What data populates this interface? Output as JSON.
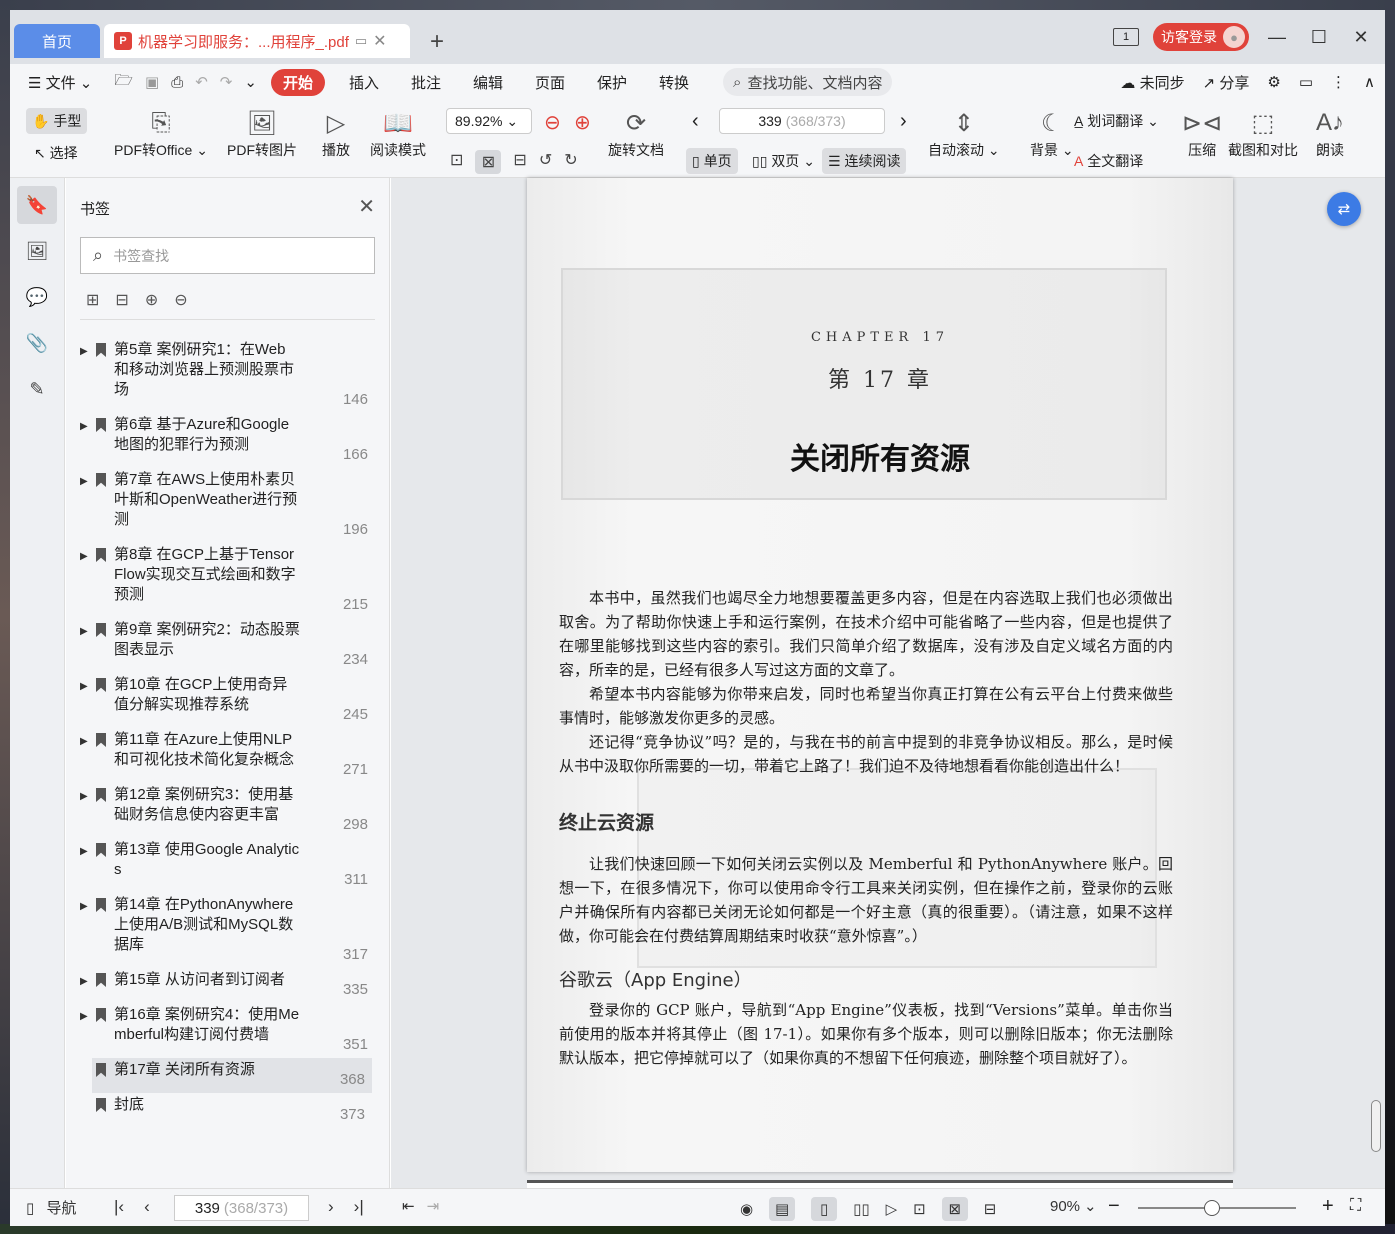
{
  "window": {
    "home_tab": "首页",
    "doc_tab": "机器学习即服务：...用程序_.pdf",
    "login": "访客登录",
    "page_badge": "1"
  },
  "menu": {
    "file": "文件",
    "items": [
      "开始",
      "插入",
      "批注",
      "编辑",
      "页面",
      "保护",
      "转换"
    ],
    "search": "查找功能、文档内容",
    "sync": "未同步",
    "share": "分享"
  },
  "toolbar": {
    "hand": "手型",
    "select": "选择",
    "pdf_office": "PDF转Office",
    "pdf_image": "PDF转图片",
    "play": "播放",
    "read_mode": "阅读模式",
    "zoom": "89.92%",
    "rotate": "旋转文档",
    "page_current": "339",
    "page_total": "(368/373)",
    "single": "单页",
    "double": "双页",
    "continuous": "连续阅读",
    "auto_scroll": "自动滚动",
    "background": "背景",
    "word_translate": "划词翻译",
    "full_translate": "全文翻译",
    "compress": "压缩",
    "screenshot": "截图和对比",
    "read_aloud": "朗读"
  },
  "bookmarks": {
    "title": "书签",
    "search_placeholder": "书签查找",
    "items": [
      {
        "label": "第5章 案例研究1：在Web和移动浏览器上预测股票市场",
        "page": "146"
      },
      {
        "label": "第6章 基于Azure和Google地图的犯罪行为预测",
        "page": "166"
      },
      {
        "label": "第7章 在AWS上使用朴素贝叶斯和OpenWeather进行预测",
        "page": "196"
      },
      {
        "label": "第8章 在GCP上基于TensorFlow实现交互式绘画和数字预测",
        "page": "215"
      },
      {
        "label": "第9章 案例研究2：动态股票图表显示",
        "page": "234"
      },
      {
        "label": "第10章 在GCP上使用奇异值分解实现推荐系统",
        "page": "245"
      },
      {
        "label": "第11章 在Azure上使用NLP和可视化技术简化复杂概念",
        "page": "271"
      },
      {
        "label": "第12章 案例研究3：使用基础财务信息使内容更丰富",
        "page": "298"
      },
      {
        "label": "第13章 使用Google Analytics",
        "page": "311"
      },
      {
        "label": "第14章 在PythonAnywhere上使用A/B测试和MySQL数据库",
        "page": "317"
      },
      {
        "label": "第15章 从访问者到订阅者",
        "page": "335"
      },
      {
        "label": "第16章 案例研究4：使用Memberful构建订阅付费墙",
        "page": "351"
      },
      {
        "label": "第17章 关闭所有资源",
        "page": "368"
      },
      {
        "label": "封底",
        "page": "373"
      }
    ]
  },
  "document": {
    "chapter_en": "CHAPTER 17",
    "chapter_cn": "第 17 章",
    "title": "关闭所有资源",
    "para1": "本书中，虽然我们也竭尽全力地想要覆盖更多内容，但是在内容选取上我们也必须做出取舍。为了帮助你快速上手和运行案例，在技术介绍中可能省略了一些内容，但是也提供了在哪里能够找到这些内容的索引。我们只简单介绍了数据库，没有涉及自定义域名方面的内容，所幸的是，已经有很多人写过这方面的文章了。",
    "para2": "希望本书内容能够为你带来启发，同时也希望当你真正打算在公有云平台上付费来做些事情时，能够激发你更多的灵感。",
    "para3": "还记得“竞争协议”吗？是的，与我在书的前言中提到的非竞争协议相反。那么，是时候从书中汲取你所需要的一切，带着它上路了！我们迫不及待地想看看你能创造出什么！",
    "section1": "终止云资源",
    "para4": "让我们快速回顾一下如何关闭云实例以及 Memberful 和 PythonAnywhere 账户。回想一下，在很多情况下，你可以使用命令行工具来关闭实例，但在操作之前，登录你的云账户并确保所有内容都已关闭无论如何都是一个好主意（真的很重要）。（请注意，如果不这样做，你可能会在付费结算周期结束时收获“意外惊喜”。）",
    "section2": "谷歌云（App Engine）",
    "para5": "登录你的 GCP 账户，导航到“App Engine”仪表板，找到“Versions”菜单。单击你当前使用的版本并将其停止（图 17-1）。如果你有多个版本，则可以删除旧版本；你无法删除默认版本，把它停掉就可以了（如果你真的不想留下任何痕迹，删除整个项目就好了）。"
  },
  "status": {
    "nav": "导航",
    "page_current": "339",
    "page_total": "(368/373)",
    "zoom": "90%"
  }
}
